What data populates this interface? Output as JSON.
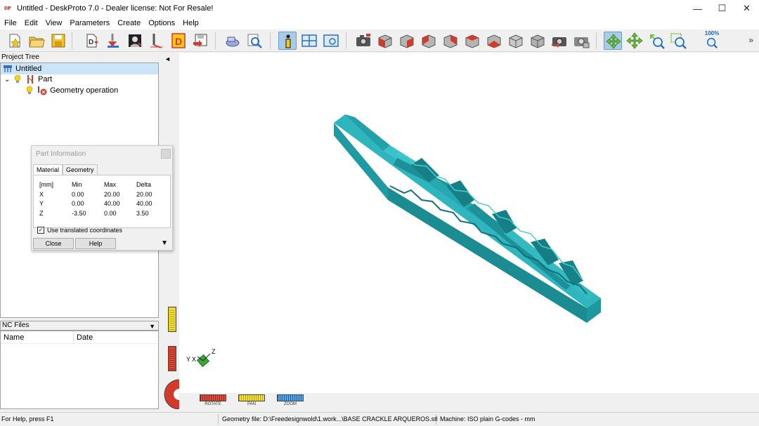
{
  "window": {
    "title": "Untitled - DeskProto 7.0 - Dealer license: Not For Resale!",
    "app_icon_text": "DP",
    "minimize": "—",
    "maximize": "☐",
    "close": "✕"
  },
  "menu": [
    "File",
    "Edit",
    "View",
    "Parameters",
    "Create",
    "Options",
    "Help"
  ],
  "toolbar": {
    "zoom_label": "100%",
    "more": "»",
    "icons": [
      "new-file-icon",
      "open-folder-icon",
      "save-icon",
      "import-part-icon",
      "import-operation-icon",
      "import-bitmap-icon",
      "cutter-icon",
      "drawing-icon",
      "save-as-icon",
      "preview-icon",
      "inspect-icon",
      "info-icon",
      "layout-icon",
      "view-icon",
      "screenshot-icon",
      "view-front-icon",
      "view-back-icon",
      "view-left-icon",
      "view-right-icon",
      "view-top-icon",
      "view-bottom-icon",
      "view-iso1-icon",
      "view-iso2-icon",
      "view-iso3-icon",
      "render-icon",
      "render2-icon",
      "rotate-tool-icon",
      "pan-tool-icon",
      "zoom-tool-icon",
      "zoom-window-icon",
      "zoom-100-icon"
    ]
  },
  "project_tree": {
    "header": "Project Tree",
    "root": "Untitled",
    "part": "Part",
    "operation": "Geometry operation",
    "expand_glyph": "⌄"
  },
  "part_info": {
    "title": "Part Information",
    "tabs": [
      "Material",
      "Geometry"
    ],
    "columns": [
      "[mm]",
      "Min",
      "Max",
      "Delta"
    ],
    "rows": [
      [
        "X",
        "0.00",
        "20.00",
        "20.00"
      ],
      [
        "Y",
        "0.00",
        "40.00",
        "40.00"
      ],
      [
        "Z",
        "-3.50",
        "0.00",
        "3.50"
      ]
    ],
    "use_translated_label": "Use translated coordinates",
    "use_translated_checked": true,
    "check_mark": "✓",
    "close_button": "Close",
    "help_button": "Help",
    "expand_glyph": "▼"
  },
  "nc_files": {
    "header": "NC Files",
    "dropdown_glyph": "▼",
    "columns": [
      "Name",
      "Date"
    ]
  },
  "viewport": {
    "collapse_glyph": "◄",
    "axis_labels": [
      "Y",
      "X",
      "Z"
    ],
    "controls": [
      {
        "label": "ROTATE",
        "color": "#d43a2a"
      },
      {
        "label": "PAN",
        "color": "#e8d21c"
      },
      {
        "label": "ZOOM",
        "color": "#3a8ed8"
      }
    ],
    "model_color": "#24a8b0"
  },
  "status": {
    "help": "For Help, press F1",
    "geometry_file": "Geometry file: D:\\Freedesignwold\\1.work...\\BASE CRACKLE ARQUEROS.stl",
    "machine": "Machine: ISO plain G-codes - mm"
  }
}
